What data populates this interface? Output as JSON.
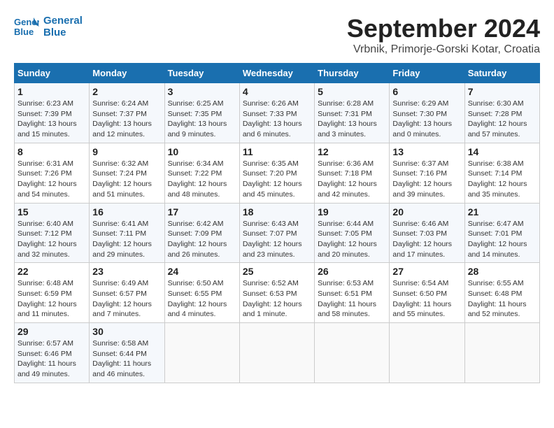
{
  "header": {
    "logo_line1": "General",
    "logo_line2": "Blue",
    "title": "September 2024",
    "subtitle": "Vrbnik, Primorje-Gorski Kotar, Croatia"
  },
  "weekdays": [
    "Sunday",
    "Monday",
    "Tuesday",
    "Wednesday",
    "Thursday",
    "Friday",
    "Saturday"
  ],
  "weeks": [
    [
      {
        "day": "1",
        "info": "Sunrise: 6:23 AM\nSunset: 7:39 PM\nDaylight: 13 hours and 15 minutes."
      },
      {
        "day": "2",
        "info": "Sunrise: 6:24 AM\nSunset: 7:37 PM\nDaylight: 13 hours and 12 minutes."
      },
      {
        "day": "3",
        "info": "Sunrise: 6:25 AM\nSunset: 7:35 PM\nDaylight: 13 hours and 9 minutes."
      },
      {
        "day": "4",
        "info": "Sunrise: 6:26 AM\nSunset: 7:33 PM\nDaylight: 13 hours and 6 minutes."
      },
      {
        "day": "5",
        "info": "Sunrise: 6:28 AM\nSunset: 7:31 PM\nDaylight: 13 hours and 3 minutes."
      },
      {
        "day": "6",
        "info": "Sunrise: 6:29 AM\nSunset: 7:30 PM\nDaylight: 13 hours and 0 minutes."
      },
      {
        "day": "7",
        "info": "Sunrise: 6:30 AM\nSunset: 7:28 PM\nDaylight: 12 hours and 57 minutes."
      }
    ],
    [
      {
        "day": "8",
        "info": "Sunrise: 6:31 AM\nSunset: 7:26 PM\nDaylight: 12 hours and 54 minutes."
      },
      {
        "day": "9",
        "info": "Sunrise: 6:32 AM\nSunset: 7:24 PM\nDaylight: 12 hours and 51 minutes."
      },
      {
        "day": "10",
        "info": "Sunrise: 6:34 AM\nSunset: 7:22 PM\nDaylight: 12 hours and 48 minutes."
      },
      {
        "day": "11",
        "info": "Sunrise: 6:35 AM\nSunset: 7:20 PM\nDaylight: 12 hours and 45 minutes."
      },
      {
        "day": "12",
        "info": "Sunrise: 6:36 AM\nSunset: 7:18 PM\nDaylight: 12 hours and 42 minutes."
      },
      {
        "day": "13",
        "info": "Sunrise: 6:37 AM\nSunset: 7:16 PM\nDaylight: 12 hours and 39 minutes."
      },
      {
        "day": "14",
        "info": "Sunrise: 6:38 AM\nSunset: 7:14 PM\nDaylight: 12 hours and 35 minutes."
      }
    ],
    [
      {
        "day": "15",
        "info": "Sunrise: 6:40 AM\nSunset: 7:12 PM\nDaylight: 12 hours and 32 minutes."
      },
      {
        "day": "16",
        "info": "Sunrise: 6:41 AM\nSunset: 7:11 PM\nDaylight: 12 hours and 29 minutes."
      },
      {
        "day": "17",
        "info": "Sunrise: 6:42 AM\nSunset: 7:09 PM\nDaylight: 12 hours and 26 minutes."
      },
      {
        "day": "18",
        "info": "Sunrise: 6:43 AM\nSunset: 7:07 PM\nDaylight: 12 hours and 23 minutes."
      },
      {
        "day": "19",
        "info": "Sunrise: 6:44 AM\nSunset: 7:05 PM\nDaylight: 12 hours and 20 minutes."
      },
      {
        "day": "20",
        "info": "Sunrise: 6:46 AM\nSunset: 7:03 PM\nDaylight: 12 hours and 17 minutes."
      },
      {
        "day": "21",
        "info": "Sunrise: 6:47 AM\nSunset: 7:01 PM\nDaylight: 12 hours and 14 minutes."
      }
    ],
    [
      {
        "day": "22",
        "info": "Sunrise: 6:48 AM\nSunset: 6:59 PM\nDaylight: 12 hours and 11 minutes."
      },
      {
        "day": "23",
        "info": "Sunrise: 6:49 AM\nSunset: 6:57 PM\nDaylight: 12 hours and 7 minutes."
      },
      {
        "day": "24",
        "info": "Sunrise: 6:50 AM\nSunset: 6:55 PM\nDaylight: 12 hours and 4 minutes."
      },
      {
        "day": "25",
        "info": "Sunrise: 6:52 AM\nSunset: 6:53 PM\nDaylight: 12 hours and 1 minute."
      },
      {
        "day": "26",
        "info": "Sunrise: 6:53 AM\nSunset: 6:51 PM\nDaylight: 11 hours and 58 minutes."
      },
      {
        "day": "27",
        "info": "Sunrise: 6:54 AM\nSunset: 6:50 PM\nDaylight: 11 hours and 55 minutes."
      },
      {
        "day": "28",
        "info": "Sunrise: 6:55 AM\nSunset: 6:48 PM\nDaylight: 11 hours and 52 minutes."
      }
    ],
    [
      {
        "day": "29",
        "info": "Sunrise: 6:57 AM\nSunset: 6:46 PM\nDaylight: 11 hours and 49 minutes."
      },
      {
        "day": "30",
        "info": "Sunrise: 6:58 AM\nSunset: 6:44 PM\nDaylight: 11 hours and 46 minutes."
      },
      {
        "day": "",
        "info": ""
      },
      {
        "day": "",
        "info": ""
      },
      {
        "day": "",
        "info": ""
      },
      {
        "day": "",
        "info": ""
      },
      {
        "day": "",
        "info": ""
      }
    ]
  ]
}
